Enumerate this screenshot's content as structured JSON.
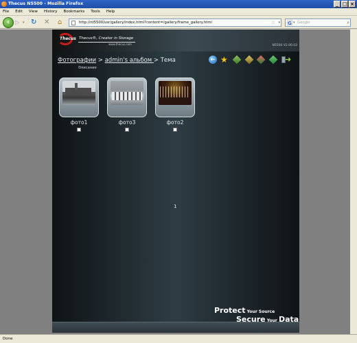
{
  "window": {
    "title": "Thecus N5500 - Mozilla Firefox",
    "controls": [
      "_",
      "□",
      "×"
    ]
  },
  "menu": [
    "File",
    "Edit",
    "View",
    "History",
    "Bookmarks",
    "Tools",
    "Help"
  ],
  "navigation": {
    "url": "http://nt5500/usr/gallery/index.html?content=/gallery/frame_gallery.html",
    "search_placeholder": "Google"
  },
  "app": {
    "brand": "Thecus",
    "tagline": "Thecus®, Creator in Storage",
    "brand_url": "www.thecus.com",
    "version": "N5500  V2.00.03",
    "breadcrumb": {
      "link1": "Фотографии",
      "sep1": " > ",
      "link2": "admin's альбом ",
      "sep2": " > ",
      "current": "Тема"
    },
    "subtitle": "Описание",
    "photos": [
      {
        "caption": "фото1"
      },
      {
        "caption": "фото3"
      },
      {
        "caption": "фото2"
      }
    ],
    "page_number": "1",
    "slogan": {
      "line1_big": "Protect",
      "line1_small": " Your Source",
      "line2_big": "Secure",
      "line2_small": " Your ",
      "line2_big2": "Data"
    }
  },
  "status": "Done",
  "colors": {
    "titlebar": "#1f4ea8",
    "app_bg": "#2e3d44",
    "chrome": "#ece9d8"
  }
}
